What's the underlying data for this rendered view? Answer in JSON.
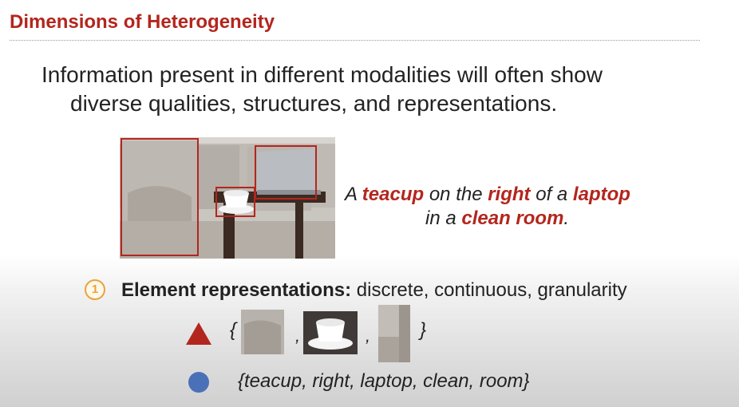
{
  "title": "Dimensions of Heterogeneity",
  "body": {
    "line1": "Information present in different modalities will often show",
    "line2": "diverse qualities, structures, and representations."
  },
  "caption": {
    "p1": "A ",
    "w1": "teacup",
    "p2": " on the ",
    "w2": "right",
    "p3": " of a ",
    "w3": "laptop",
    "p4": "in a ",
    "w4": "clean room",
    "p5": "."
  },
  "element": {
    "number": "1",
    "label": "Element representations:",
    "desc": " discrete, continuous, granularity"
  },
  "visual_set": {
    "open": "{",
    "close": "}",
    "sep": ","
  },
  "text_set": "{teacup, right, laptop, clean, room}",
  "colors": {
    "accent": "#b3261e",
    "orange": "#e8a33d",
    "blue": "#4a70b7"
  }
}
